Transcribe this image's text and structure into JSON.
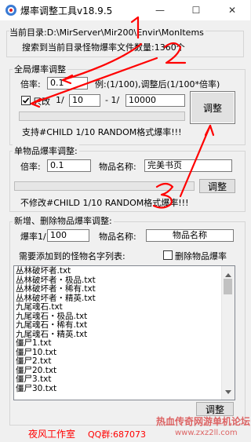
{
  "window": {
    "title": "爆率调整工具v18.9.5",
    "minimize_glyph": "—",
    "maximize_glyph": "☐",
    "close_glyph": "✕"
  },
  "current_dir": {
    "label": "当前目录:",
    "path": "D:\\MirServer\\Mir200\\Envir\\MonItems",
    "search_result": "搜索到当前目录怪物爆率文件数量:1360个"
  },
  "global_section": {
    "title": "全局爆率调整",
    "rate_label": "倍率:",
    "rate_value": "0.1",
    "example_text": "例:(1/100),调整后(1/100*倍率)",
    "only_change_label": "只改",
    "only_change_checked": true,
    "ratio_prefix": "1/",
    "ratio_from": "10",
    "ratio_sep": "- 1/",
    "ratio_to": "10000",
    "adjust_button": "调整",
    "hint": "支持#CHILD 1/10 RANDOM格式爆率!!!"
  },
  "single_section": {
    "title": "单物品爆率调整:",
    "rate_label": "倍率:",
    "rate_value": "0.1",
    "item_label": "物品名称:",
    "item_value": "完美书页",
    "adjust_button": "调整",
    "hint": "不修改#CHILD 1/10 RANDOM格式爆率!!!"
  },
  "add_delete_section": {
    "title": "新增、删除物品爆率调整:",
    "rate_label": "爆率1/",
    "rate_value": "100",
    "item_label": "物品名称:",
    "item_value": "物品名称",
    "need_add_label": "需要添加到的怪物名字列表:",
    "delete_label": "删除物品爆率",
    "delete_checked": false,
    "monster_files": [
      "丛林破坏者.txt",
      "丛林破坏者・极品.txt",
      "丛林破坏者・稀有.txt",
      "丛林破坏者・精英.txt",
      "九尾魂石.txt",
      "九尾魂石・极品.txt",
      "九尾魂石・稀有.txt",
      "九尾魂石・精英.txt",
      "僵尸1.txt",
      "僵尸10.txt",
      "僵尸2.txt",
      "僵尸20.txt",
      "僵尸3.txt",
      "僵尸30.txt"
    ],
    "adjust_button": "调整"
  },
  "footer": {
    "studio": "夜风工作室",
    "qq": "QQ群:687073"
  },
  "watermark": {
    "line1": "热血传奇网游单机论坛",
    "line2": "www.zxz2ll.com"
  },
  "annotation": {
    "marker_1": "1",
    "marker_2": "2",
    "marker_3": "3",
    "color": "#ff0000"
  }
}
